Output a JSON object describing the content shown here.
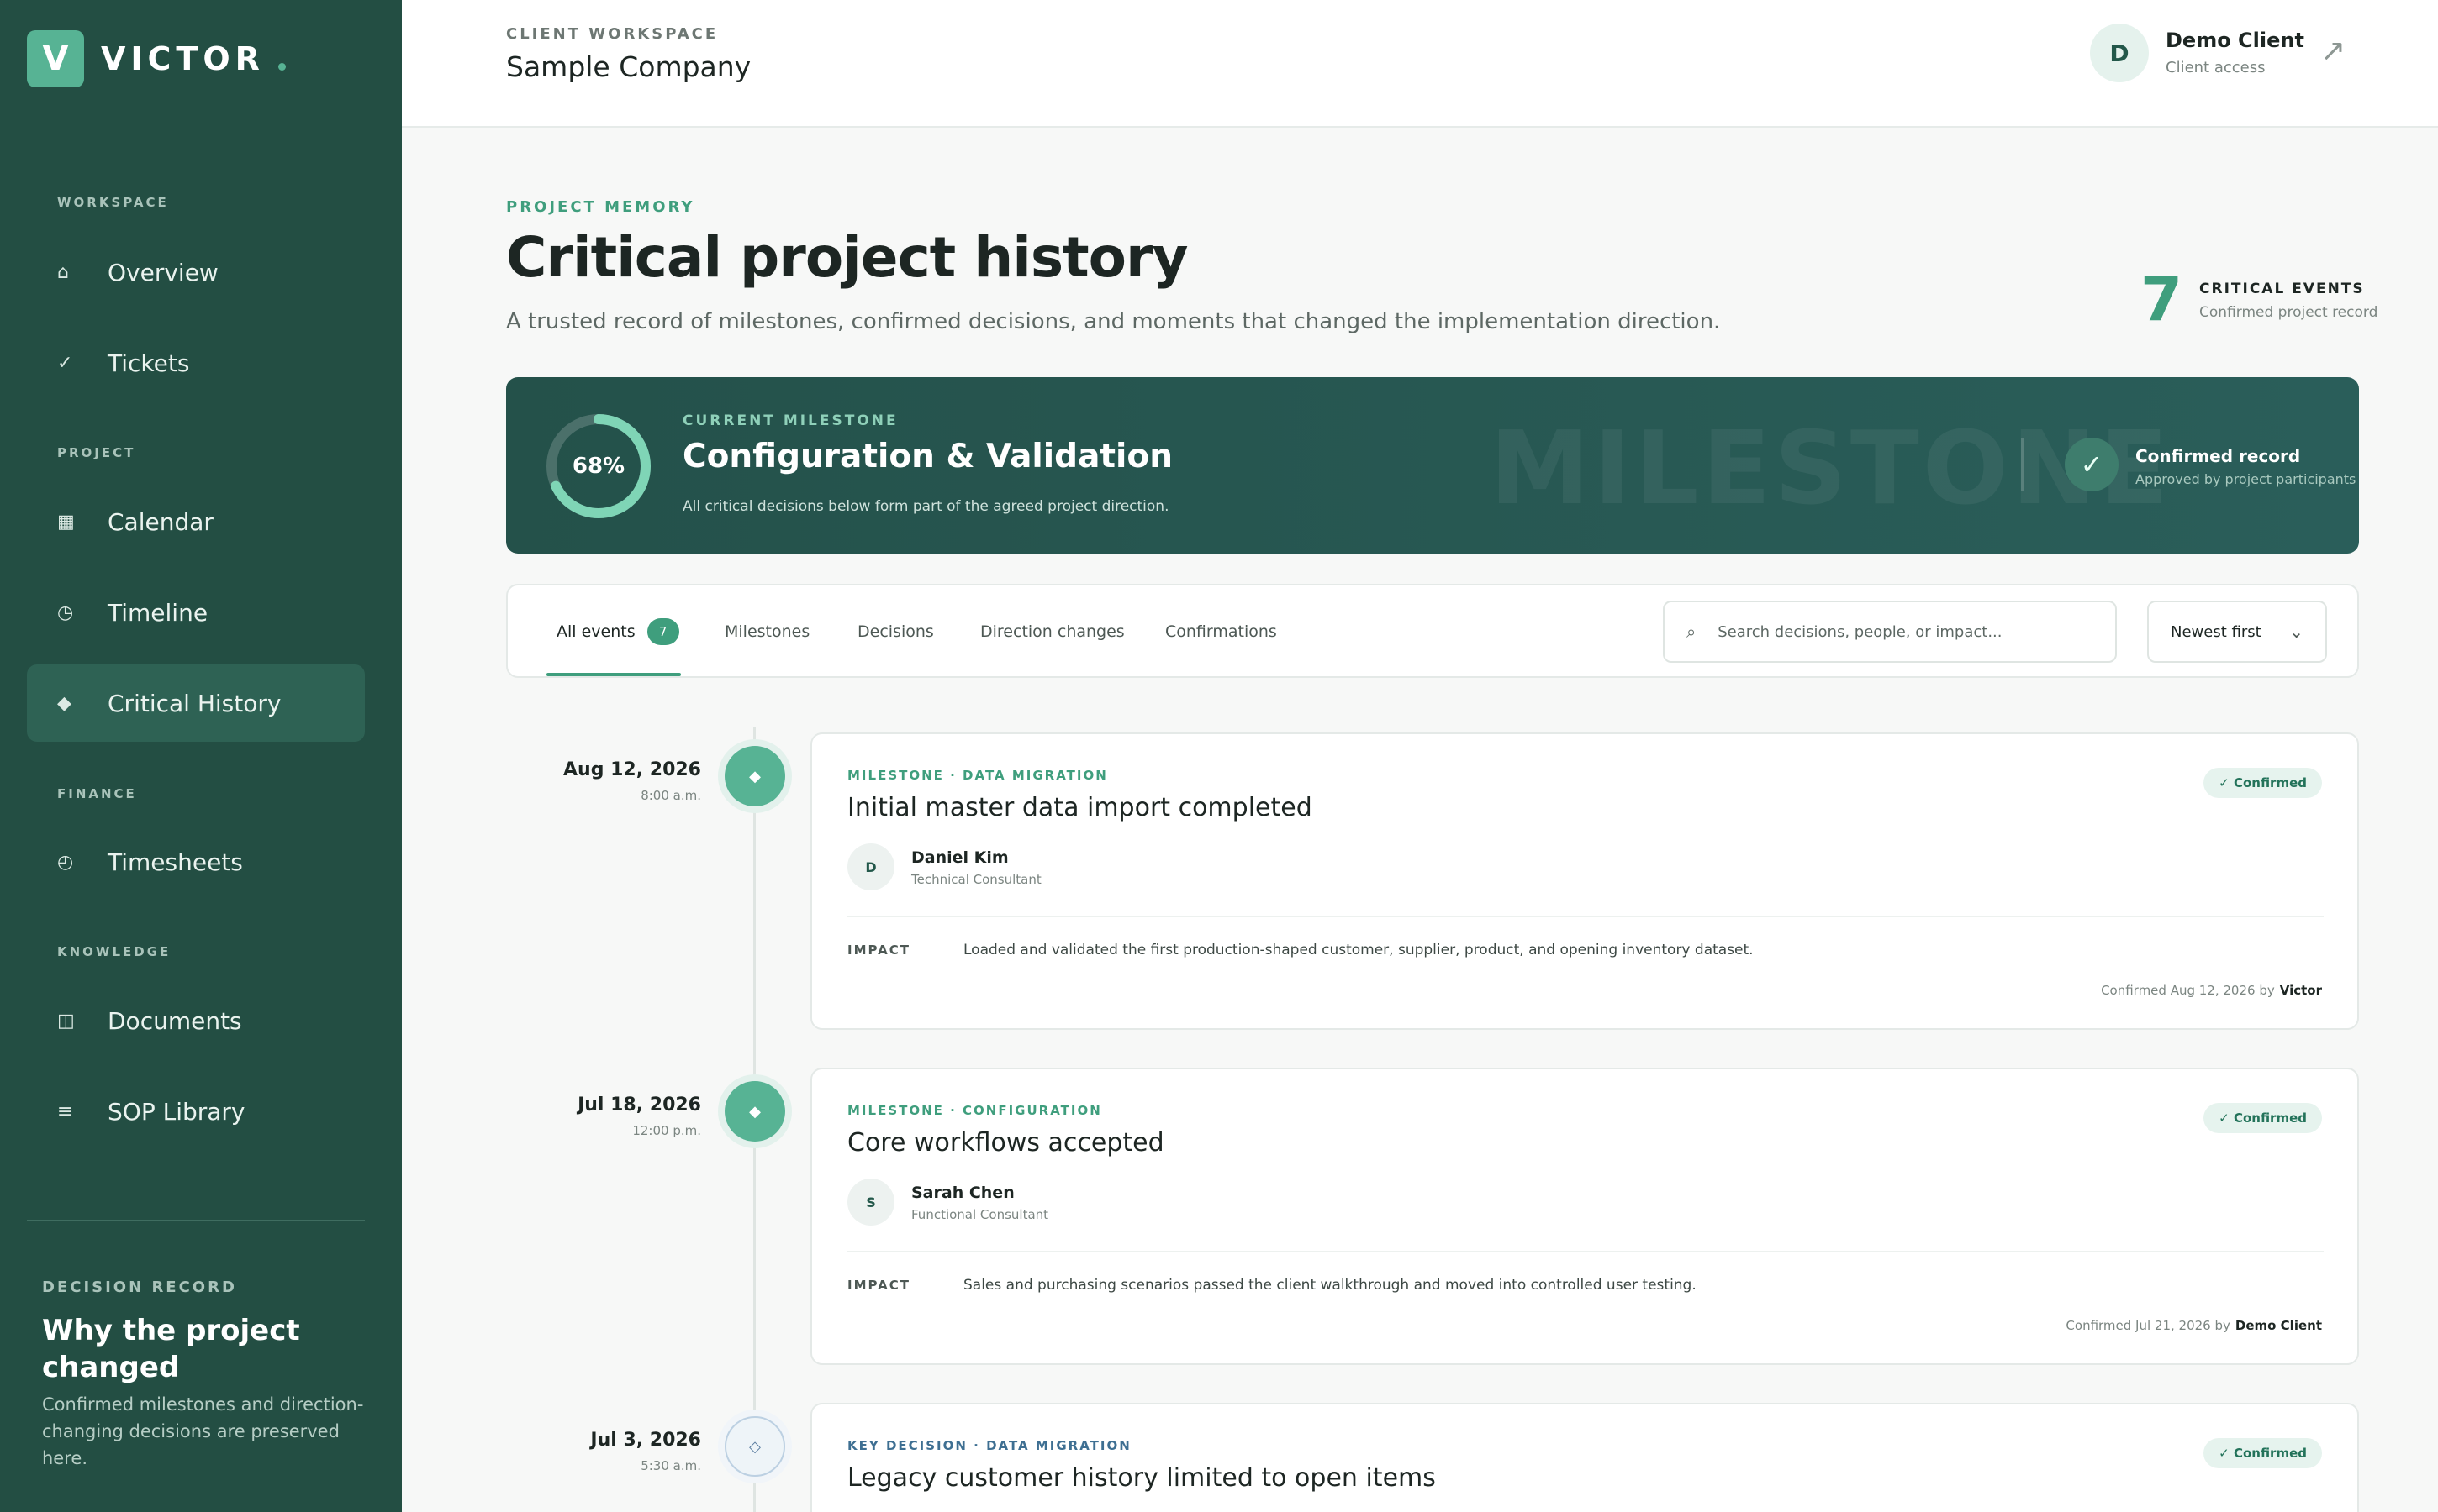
{
  "brand": {
    "logo_letter": "V",
    "name": "VICTOR",
    "dot": "."
  },
  "sidebar": {
    "sections": {
      "workspace": "WORKSPACE",
      "project": "PROJECT",
      "finance": "FINANCE",
      "knowledge": "KNOWLEDGE"
    },
    "items": [
      {
        "label": "Overview",
        "icon": "home-icon"
      },
      {
        "label": "Tickets",
        "icon": "check-icon"
      },
      {
        "label": "Calendar",
        "icon": "calendar-icon"
      },
      {
        "label": "Timeline",
        "icon": "clock-icon"
      },
      {
        "label": "Critical History",
        "icon": "diamond-icon",
        "active": true
      },
      {
        "label": "Timesheets",
        "icon": "timer-icon"
      },
      {
        "label": "Documents",
        "icon": "book-icon"
      },
      {
        "label": "SOP Library",
        "icon": "list-icon"
      }
    ],
    "decision_record": {
      "eyebrow": "DECISION RECORD",
      "title": "Why the project changed",
      "text": "Confirmed milestones and direction-changing decisions are preserved here."
    }
  },
  "topbar": {
    "eyebrow": "CLIENT WORKSPACE",
    "workspace": "Sample Company",
    "user": {
      "initial": "D",
      "name": "Demo Client",
      "role": "Client access"
    },
    "external_icon": "external-link-icon"
  },
  "header": {
    "eyebrow": "PROJECT MEMORY",
    "title": "Critical project history",
    "subtitle": "A trusted record of milestones, confirmed decisions, and moments that changed the implementation direction.",
    "count": {
      "value": "7",
      "label": "CRITICAL EVENTS",
      "sub": "Confirmed project record"
    }
  },
  "banner": {
    "progress_label": "68%",
    "progress": 0.68,
    "eyebrow": "CURRENT MILESTONE",
    "title": "Configuration & Validation",
    "sub": "All critical decisions below form part of the agreed project direction.",
    "watermark": "MILESTONE",
    "confirmed_title": "Confirmed record",
    "confirmed_sub": "Approved by project participants"
  },
  "filters": {
    "tabs": [
      {
        "label": "All events",
        "badge": "7",
        "active": true
      },
      {
        "label": "Milestones"
      },
      {
        "label": "Decisions"
      },
      {
        "label": "Direction changes"
      },
      {
        "label": "Confirmations"
      }
    ],
    "search_placeholder": "Search decisions, people, or impact...",
    "sort": "Newest first"
  },
  "events": [
    {
      "date": "Aug 12, 2026",
      "time": "8:00 a.m.",
      "kind": "milestone",
      "eyebrow": "MILESTONE · DATA MIGRATION",
      "title": "Initial master data import completed",
      "status": "✓ Confirmed",
      "person": {
        "initial": "D",
        "name": "Daniel Kim",
        "role": "Technical Consultant"
      },
      "impact_label": "IMPACT",
      "impact": "Loaded and validated the first production-shaped customer, supplier, product, and opening inventory dataset.",
      "confirmed_text": "Confirmed Aug 12, 2026 by",
      "confirmed_by": "Victor"
    },
    {
      "date": "Jul 18, 2026",
      "time": "12:00 p.m.",
      "kind": "milestone",
      "eyebrow": "MILESTONE · CONFIGURATION",
      "title": "Core workflows accepted",
      "status": "✓ Confirmed",
      "person": {
        "initial": "S",
        "name": "Sarah Chen",
        "role": "Functional Consultant"
      },
      "impact_label": "IMPACT",
      "impact": "Sales and purchasing scenarios passed the client walkthrough and moved into controlled user testing.",
      "confirmed_text": "Confirmed Jul 21, 2026 by",
      "confirmed_by": "Demo Client"
    },
    {
      "date": "Jul 3, 2026",
      "time": "5:30 a.m.",
      "kind": "key-decision",
      "eyebrow": "KEY DECISION · DATA MIGRATION",
      "title": "Legacy customer history limited to open items",
      "status": "✓ Confirmed"
    }
  ],
  "colors": {
    "sidebar": "#234e43",
    "accent": "#57b394",
    "banner": "#24514a"
  }
}
